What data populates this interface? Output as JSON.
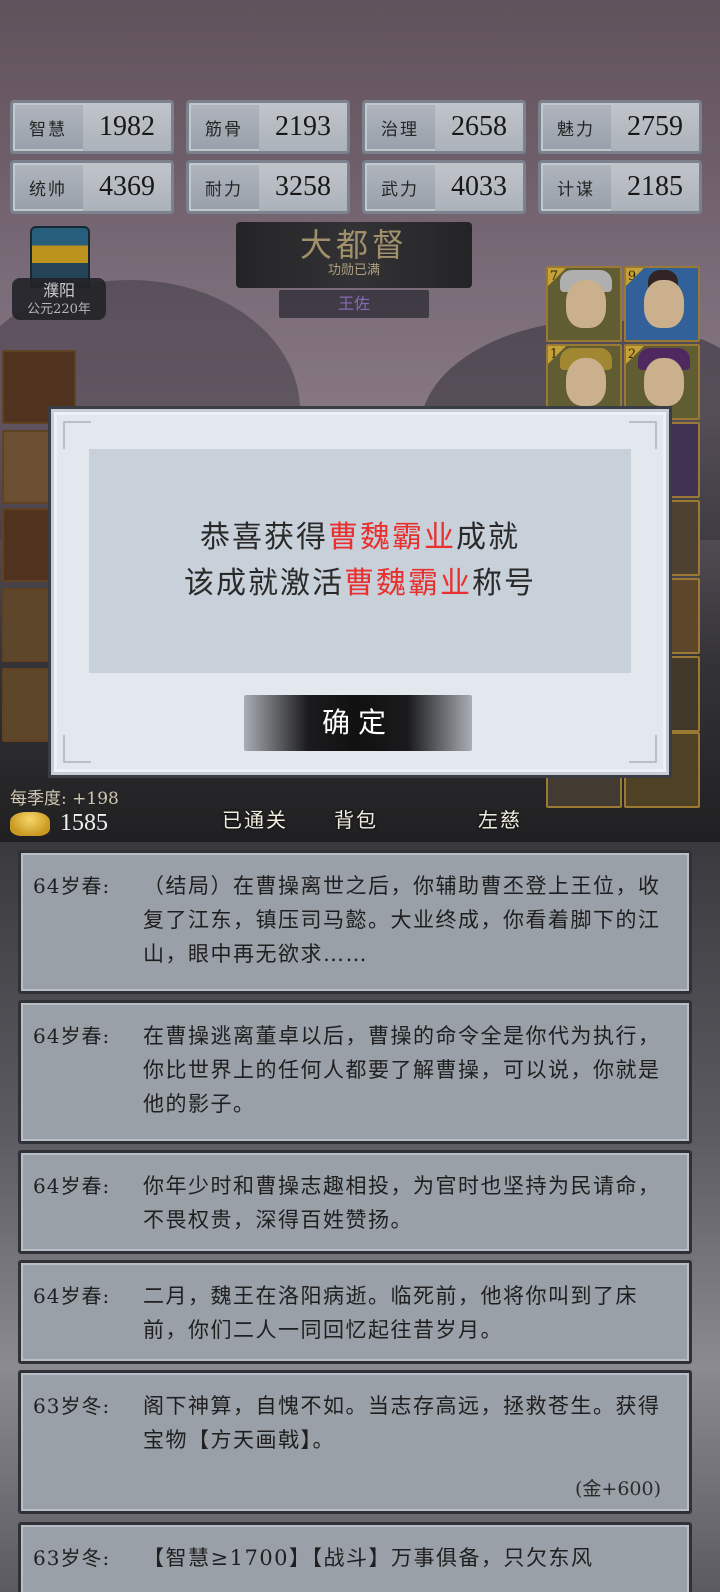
{
  "stats": [
    {
      "label": "智慧",
      "value": "1982"
    },
    {
      "label": "筋骨",
      "value": "2193"
    },
    {
      "label": "治理",
      "value": "2658"
    },
    {
      "label": "魅力",
      "value": "2759"
    },
    {
      "label": "统帅",
      "value": "4369"
    },
    {
      "label": "耐力",
      "value": "3258"
    },
    {
      "label": "武力",
      "value": "4033"
    },
    {
      "label": "计谋",
      "value": "2185"
    }
  ],
  "city": {
    "name": "濮阳",
    "year": "公元220年"
  },
  "rank": {
    "title": "大都督",
    "subtitle": "功勋已满",
    "name": "王佐"
  },
  "heroes": [
    {
      "badge": "7"
    },
    {
      "badge": "9"
    },
    {
      "badge": "1"
    },
    {
      "badge": "2"
    }
  ],
  "footer": {
    "season_income": "每季度: +198",
    "gold": "1585",
    "nav": [
      "已通关",
      "背包",
      "左慈"
    ]
  },
  "modal": {
    "line1_pre": "恭喜获得",
    "line1_hl": "曹魏霸业",
    "line1_post": "成就",
    "line2_pre": "该成就激活",
    "line2_hl": "曹魏霸业",
    "line2_post": "称号",
    "confirm": "确定"
  },
  "log": [
    {
      "age": "64岁春:",
      "text": "（结局）在曹操离世之后，你辅助曹丕登上王位，收复了江东，镇压司马懿。大业终成，你看着脚下的江山，眼中再无欲求……"
    },
    {
      "age": "64岁春:",
      "text": "在曹操逃离董卓以后，曹操的命令全是你代为执行，你比世界上的任何人都要了解曹操，可以说，你就是他的影子。"
    },
    {
      "age": "64岁春:",
      "text": "你年少时和曹操志趣相投，为官时也坚持为民请命，不畏权贵，深得百姓赞扬。"
    },
    {
      "age": "64岁春:",
      "text": "二月，魏王在洛阳病逝。临死前，他将你叫到了床前，你们二人一同回忆起往昔岁月。"
    },
    {
      "age": "63岁冬:",
      "text": "阁下神算，自愧不如。当志存高远，拯救苍生。获得宝物【方天画戟】。",
      "reward": "(金+600)"
    },
    {
      "age": "63岁冬:",
      "text": "【智慧≥1700】【战斗】万事俱备，只欠东风"
    }
  ]
}
